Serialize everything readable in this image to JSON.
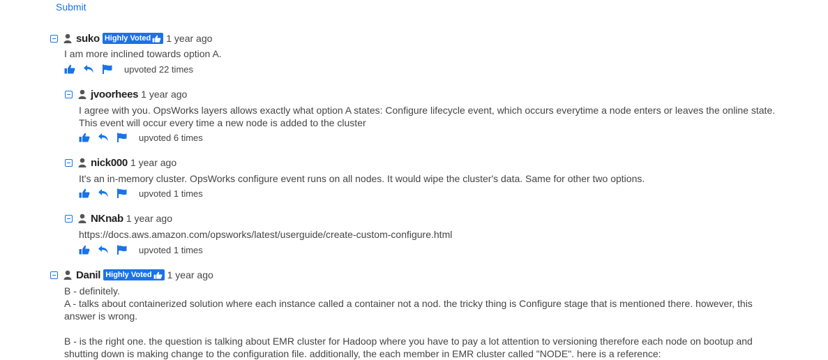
{
  "submit_label": "Submit",
  "badge_label": "Highly Voted",
  "comments": [
    {
      "user": "suko",
      "time": "1 year ago",
      "body": [
        "I am more inclined towards option A."
      ],
      "upvotes": "upvoted 22 times"
    },
    {
      "user": "jvoorhees",
      "time": "1 year ago",
      "body": [
        "I agree with you. OpsWorks layers allows exactly what option A states: Configure lifecycle event, which occurs everytime a node enters or leaves the online state.",
        "This event will occur every time a new node is added to the cluster"
      ],
      "upvotes": "upvoted 6 times"
    },
    {
      "user": "nick000",
      "time": "1 year ago",
      "body": [
        "It's an in-memory cluster. OpsWorks configure event runs on all nodes. It would wipe the cluster's data. Same for other two options."
      ],
      "upvotes": "upvoted 1 times"
    },
    {
      "user": "NKnab",
      "time": "1 year ago",
      "body": [
        "https://docs.aws.amazon.com/opsworks/latest/userguide/create-custom-configure.html"
      ],
      "upvotes": "upvoted 1 times"
    },
    {
      "user": "Danil",
      "time": "1 year ago",
      "body": [
        "B - definitely.",
        "A - talks about containerized solution where each instance called a container not a nod. the tricky thing is Configure stage that is mentioned there. however, this",
        "answer is wrong.",
        "",
        "B - is the right one. the question is talking about EMR cluster for Hadoop where you have to pay a lot attention to versioning therefore each node on bootup and",
        "shutting down is making change to the configuration file. additionally, the each member in EMR cluster called \"NODE\". here is a reference:"
      ]
    }
  ]
}
